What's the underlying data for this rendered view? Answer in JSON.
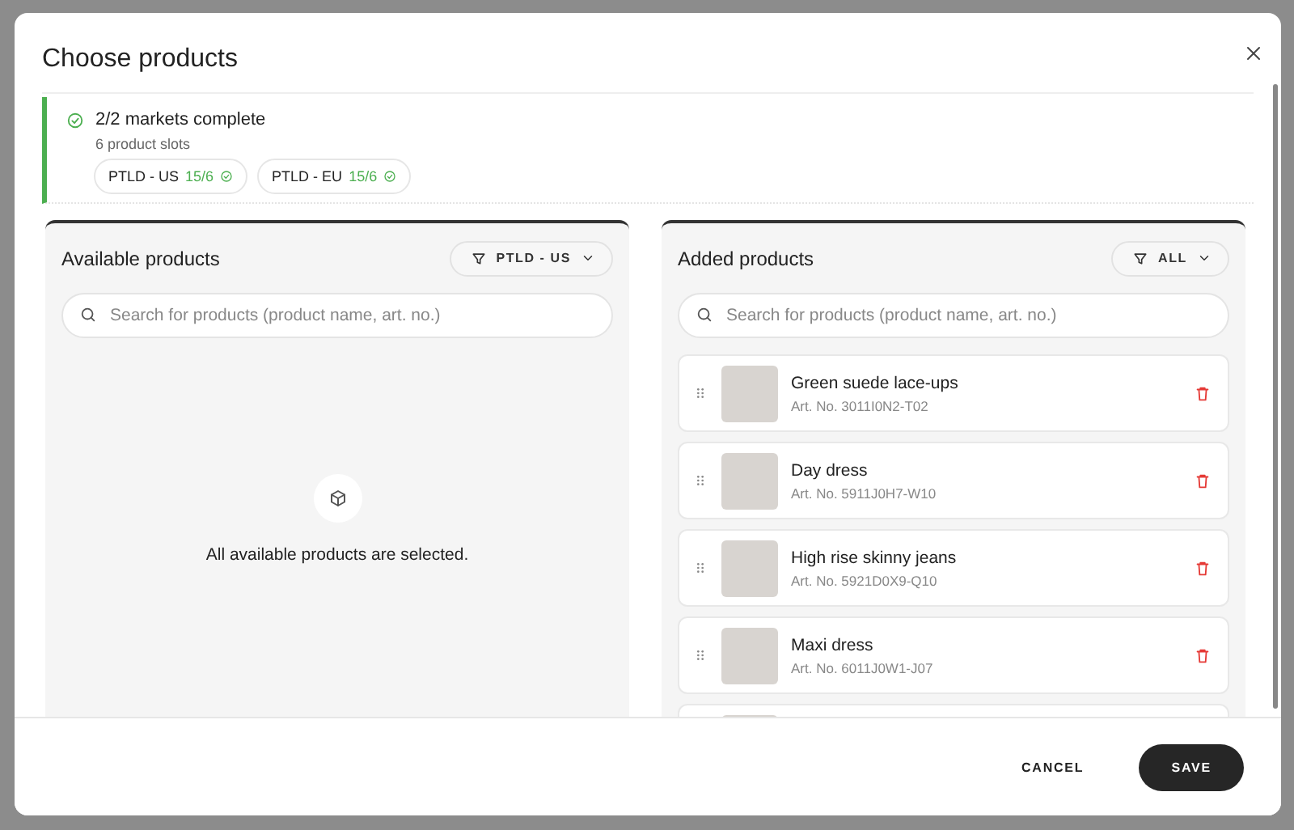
{
  "dialog": {
    "title": "Choose products"
  },
  "status": {
    "complete": true,
    "title": "2/2 markets complete",
    "subtitle": "6 product slots",
    "markets": [
      {
        "name": "PTLD - US",
        "count": "15/6",
        "complete": true
      },
      {
        "name": "PTLD - EU",
        "count": "15/6",
        "complete": true
      }
    ]
  },
  "available": {
    "title": "Available products",
    "filter": "PTLD - US",
    "search": {
      "placeholder": "Search for products (product name, art. no.)"
    },
    "empty_message": "All available products are selected."
  },
  "added": {
    "title": "Added products",
    "filter": "ALL",
    "search": {
      "placeholder": "Search for products (product name, art. no.)"
    },
    "products": [
      {
        "kind": "full",
        "name": "Green suede lace-ups",
        "art_no": "Art. No. 3011I0N2-T02"
      },
      {
        "kind": "full",
        "name": "Day dress",
        "art_no": "Art. No. 5911J0H7-W10"
      },
      {
        "kind": "full",
        "name": "High rise skinny jeans",
        "art_no": "Art. No. 5921D0X9-Q10"
      },
      {
        "kind": "full",
        "name": "Maxi dress",
        "art_no": "Art. No. 6011J0W1-J07"
      },
      {
        "kind": "cut"
      }
    ]
  },
  "buttons": [
    {
      "label": "CANCEL",
      "kind": "text"
    },
    {
      "label": "SAVE",
      "kind": "primary"
    }
  ]
}
